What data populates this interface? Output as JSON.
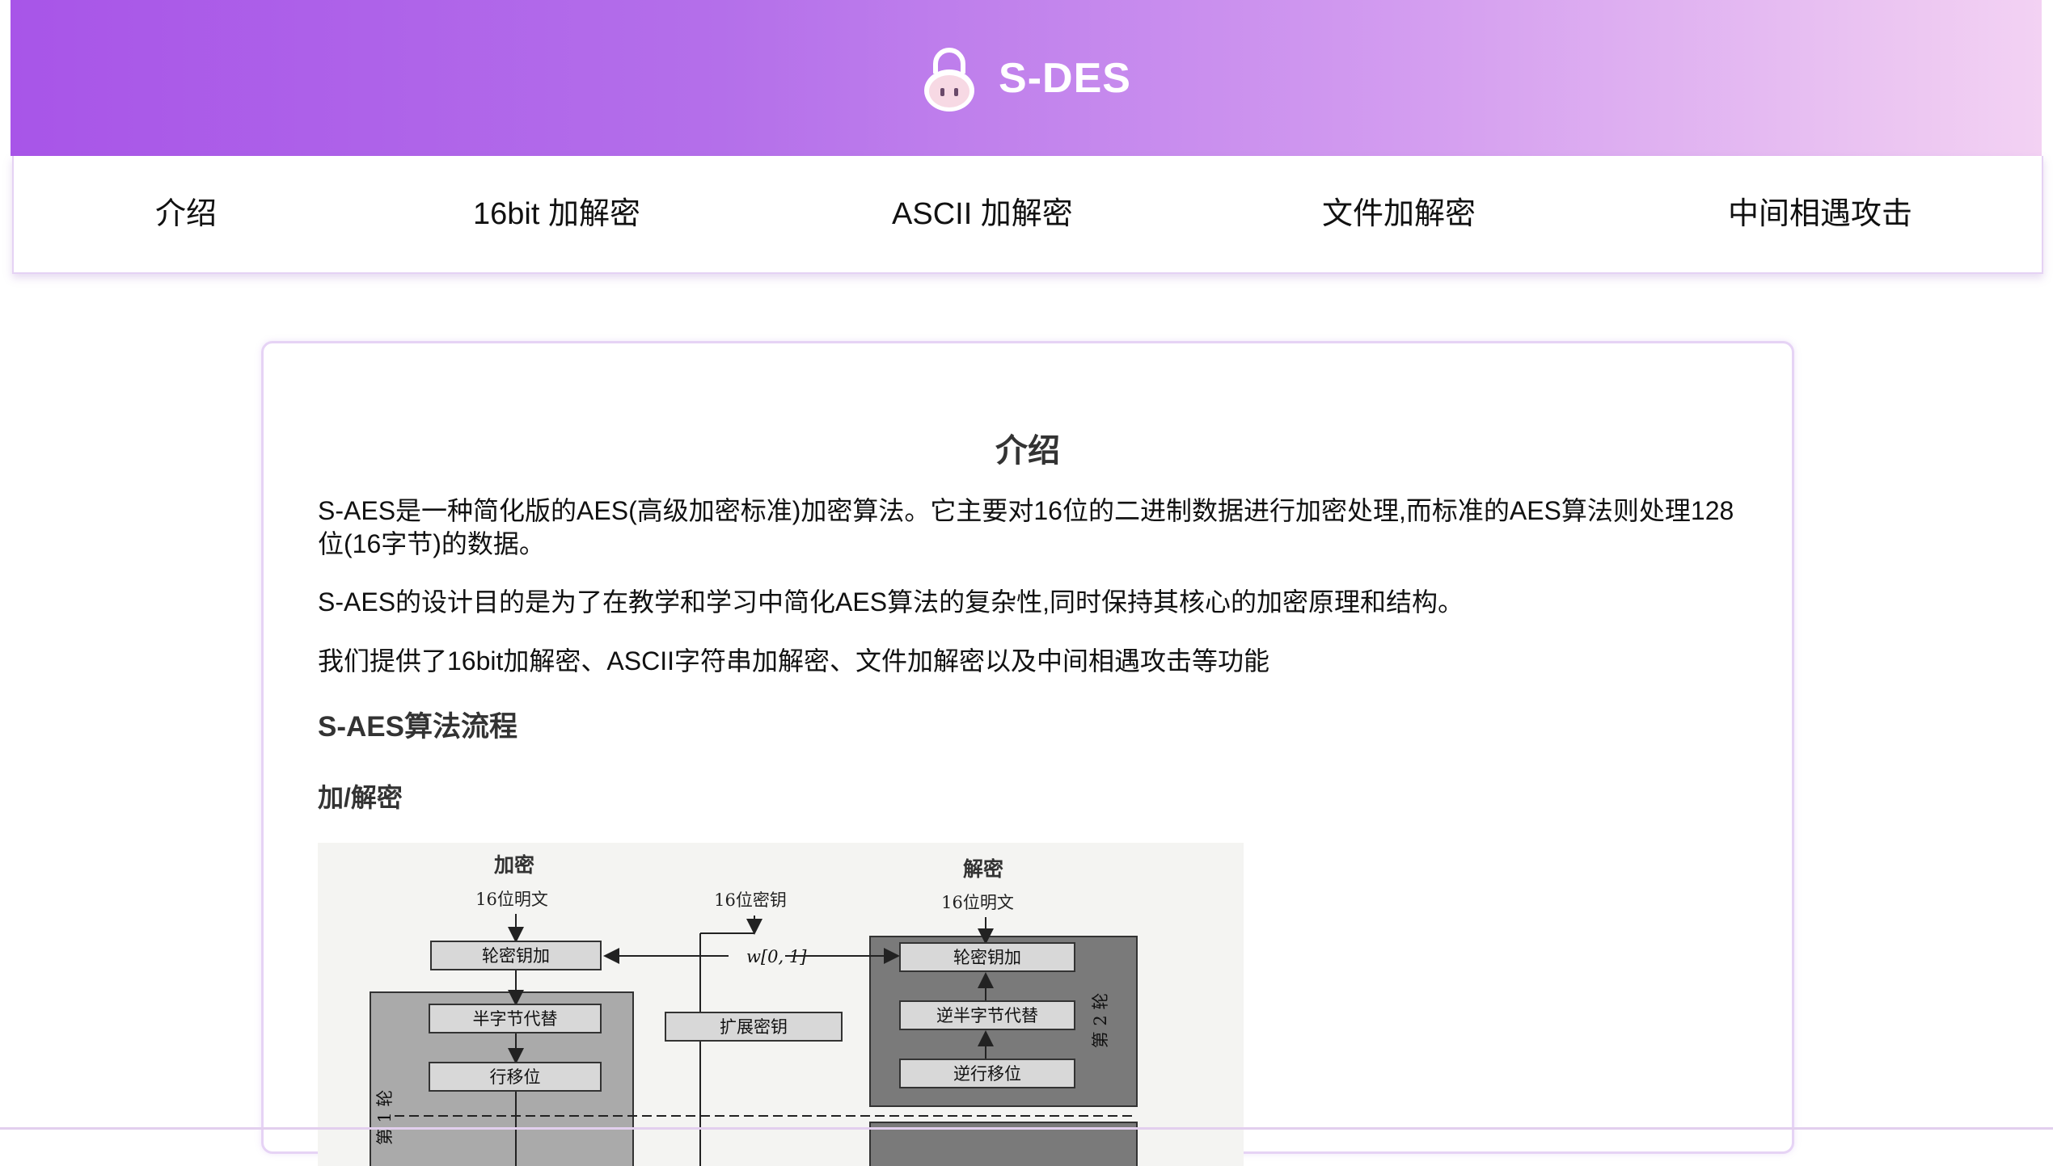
{
  "header": {
    "title": "S-DES",
    "logo_icon": "lock-mascot-icon"
  },
  "nav": {
    "items": [
      {
        "label": "介绍"
      },
      {
        "label": "16bit 加解密"
      },
      {
        "label": "ASCII 加解密"
      },
      {
        "label": "文件加解密"
      },
      {
        "label": "中间相遇攻击"
      }
    ]
  },
  "content": {
    "title": "介绍",
    "paragraphs": [
      "S-AES是一种简化版的AES(高级加密标准)加密算法。它主要对16位的二进制数据进行加密处理,而标准的AES算法则处理128位(16字节)的数据。",
      "S-AES的设计目的是为了在教学和学习中简化AES算法的复杂性,同时保持其核心的加密原理和结构。",
      "我们提供了16bit加解密、ASCII字符串加解密、文件加解密以及中间相遇攻击等功能"
    ],
    "section_title": "S-AES算法流程",
    "subsection_title": "加/解密",
    "diagram": {
      "encrypt_title": "加密",
      "decrypt_title": "解密",
      "plaintext_label": "16位明文",
      "key_label": "16位密钥",
      "w01_label": "w[0, 1]",
      "add_round_key": "轮密钥加",
      "nibble_sub": "半字节代替",
      "shift_rows": "行移位",
      "key_expansion": "扩展密钥",
      "inv_nibble_sub": "逆半字节代替",
      "inv_shift_rows": "逆行移位",
      "round2_label": "第 2 轮",
      "round1_label": "第 1 轮"
    }
  },
  "colors": {
    "header_start": "#a855e8",
    "header_end": "#f3d2f3",
    "card_border": "#e6d3f5"
  }
}
